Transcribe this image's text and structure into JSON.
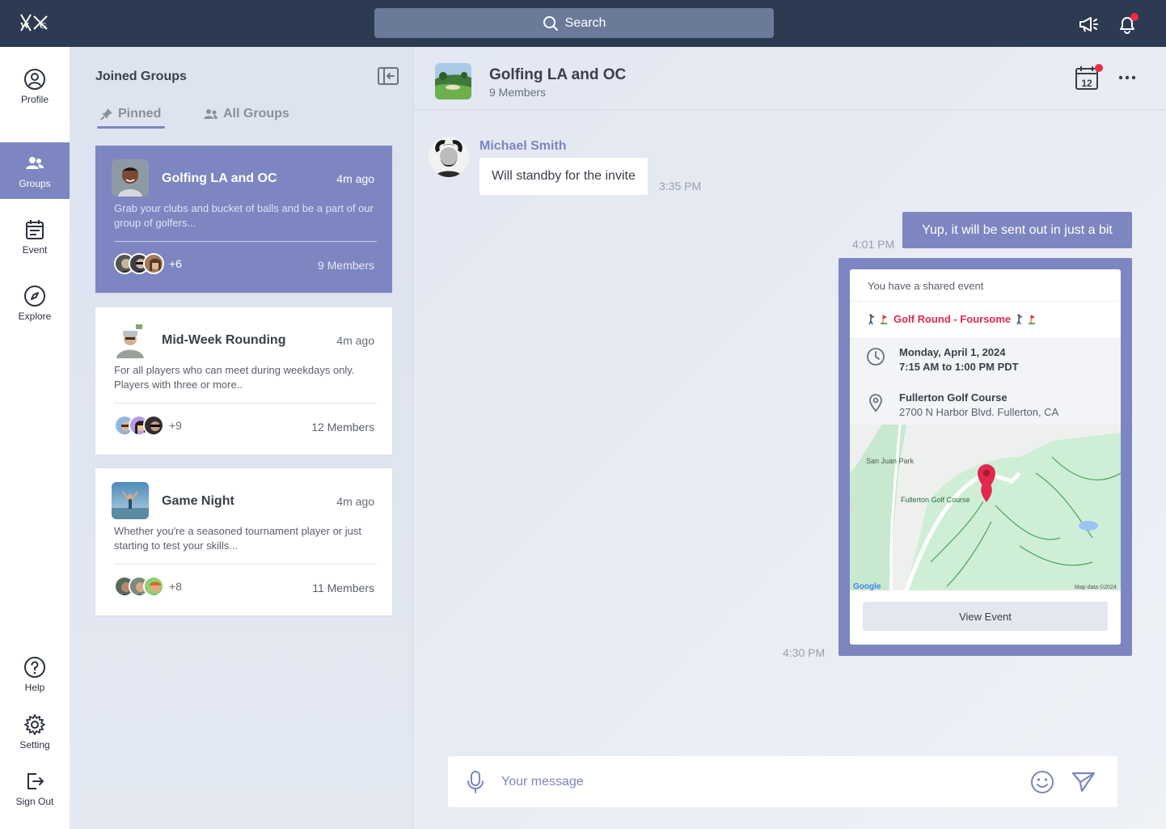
{
  "topbar": {
    "logo_text": "W/G",
    "search_label": "Search"
  },
  "nav": {
    "items": [
      {
        "label": "Profile",
        "icon": "user-circle-icon"
      },
      {
        "label": "Groups",
        "icon": "users-icon"
      },
      {
        "label": "Event",
        "icon": "calendar-list-icon"
      },
      {
        "label": "Explore",
        "icon": "compass-icon"
      },
      {
        "label": "Help",
        "icon": "help-icon"
      },
      {
        "label": "Setting",
        "icon": "gear-icon"
      },
      {
        "label": "Sign Out",
        "icon": "sign-out-icon"
      }
    ],
    "active": "Groups"
  },
  "groups_panel": {
    "title": "Joined Groups",
    "tabs": [
      {
        "label": "Pinned",
        "icon": "pin-icon",
        "active": true
      },
      {
        "label": "All Groups",
        "icon": "users-icon",
        "active": false
      }
    ],
    "cards": [
      {
        "name": "Golfing LA and OC",
        "time": "4m ago",
        "description": "Grab your clubs and bucket of balls and be a part of our group of golfers...",
        "extra": "+6",
        "members": "9 Members",
        "active": true
      },
      {
        "name": "Mid-Week Rounding",
        "time": "4m ago",
        "description": "For all players who can meet during weekdays only. Players with three or more..",
        "extra": "+9",
        "members": "12 Members",
        "active": false
      },
      {
        "name": "Game Night",
        "time": "4m ago",
        "description": "Whether you're a seasoned tournament player or just starting to test your skills...",
        "extra": "+8",
        "members": "11 Members",
        "active": false
      }
    ]
  },
  "chat": {
    "title": "Golfing LA and OC",
    "subtitle": "9 Members",
    "calendar_day": "12",
    "messages": [
      {
        "sender": "Michael Smith",
        "text": "Will standby for the invite",
        "time": "3:35 PM",
        "direction": "in"
      },
      {
        "text": "Yup, it will be sent out in just a bit",
        "time": "4:01 PM",
        "direction": "out"
      }
    ],
    "event": {
      "header": "You have a shared event",
      "title": "Golf Round - Foursome",
      "date": "Monday, April 1, 2024",
      "time_range": "7:15 AM to 1:00 PM PDT",
      "venue": "Fullerton Golf Course",
      "address": "2700 N Harbor Blvd. Fullerton, CA",
      "map_labels": {
        "park": "San Juan Park",
        "course": "Fullerton Golf Course",
        "brand": "Google",
        "credit": "Map data ©2024"
      },
      "button": "View Event",
      "time": "4:30 PM"
    },
    "composer": {
      "placeholder": "Your message"
    }
  },
  "colors": {
    "accent": "#7d86c0",
    "topbar": "#2c3a52",
    "alert": "#ee2a4a"
  }
}
